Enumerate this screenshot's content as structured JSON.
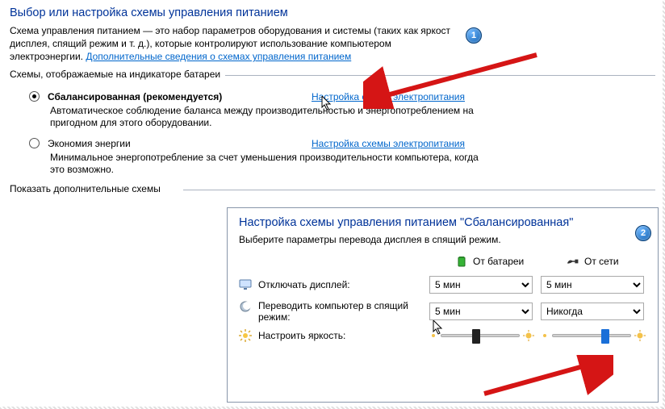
{
  "heading": "Выбор или настройка схемы управления питанием",
  "intro_line1": "Схема управления питанием — это набор параметров оборудования и системы (таких как яркост",
  "intro_line2": "дисплея, спящий режим и т. д.), которые контролируют использование компьютером",
  "intro_line3_prefix": "электроэнергии. ",
  "intro_link": "Дополнительные сведения о схемах управления питанием",
  "group_label": "Схемы, отображаемые на индикаторе батареи",
  "plans": [
    {
      "name": "Сбалансированная (рекомендуется)",
      "checked": true,
      "link": "Настройка схемы электропитания",
      "desc": "Автоматическое соблюдение баланса между производительностью и энергопотреблением на пригодном для этого оборудовании."
    },
    {
      "name": "Экономия энергии",
      "checked": false,
      "link": "Настройка схемы электропитания",
      "desc": "Минимальное энергопотребление за счет уменьшения производительности компьютера, когда это возможно."
    }
  ],
  "show_more_label": "Показать дополнительные схемы",
  "sub": {
    "heading": "Настройка схемы управления питанием \"Сбалансированная\"",
    "desc": "Выберите параметры перевода дисплея в спящий режим.",
    "col_battery": "От батареи",
    "col_ac": "От сети",
    "rows": {
      "display_off": {
        "label": "Отключать дисплей:",
        "battery": "5 мин",
        "ac": "5 мин"
      },
      "sleep": {
        "label": "Переводить компьютер в спящий режим:",
        "battery": "5 мин",
        "ac": "Никогда"
      },
      "brightness": {
        "label": "Настроить яркость:",
        "battery_pct": 40,
        "ac_pct": 62
      }
    }
  },
  "annotations": {
    "badge1": "1",
    "badge2": "2"
  }
}
